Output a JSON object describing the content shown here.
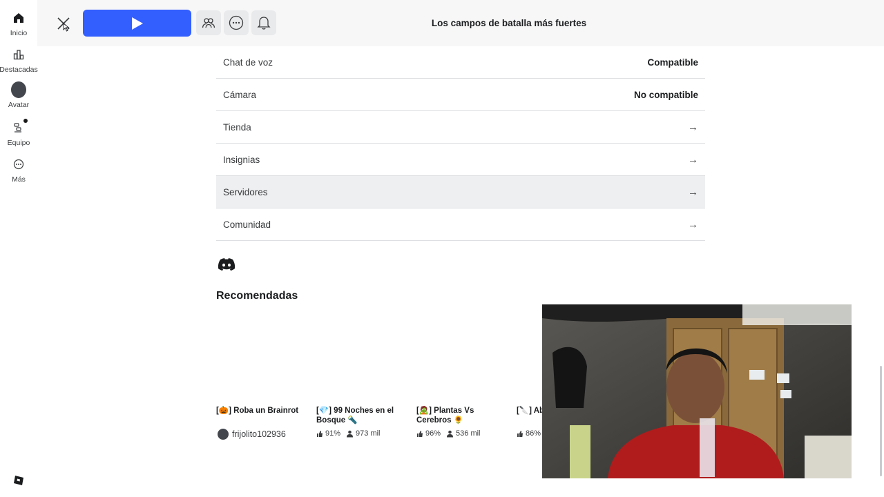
{
  "sidebar": {
    "items": [
      {
        "label": "Inicio",
        "icon": "home-icon"
      },
      {
        "label": "Destacadas",
        "icon": "charts-icon"
      },
      {
        "label": "Avatar",
        "icon": "avatar-icon"
      },
      {
        "label": "Equipo",
        "icon": "party-icon"
      },
      {
        "label": "Más",
        "icon": "more-icon"
      }
    ]
  },
  "topbar": {
    "title": "Los campos de batalla más fuertes",
    "play_color": "#335fff"
  },
  "info_rows": [
    {
      "key": "Chat de voz",
      "value": "Compatible"
    },
    {
      "key": "Cámara",
      "value": "No compatible"
    },
    {
      "key": "Tienda",
      "value": "→"
    },
    {
      "key": "Insignias",
      "value": "→"
    },
    {
      "key": "Servidores",
      "value": "→"
    },
    {
      "key": "Comunidad",
      "value": "→"
    }
  ],
  "recommended": {
    "title": "Recomendadas",
    "cards": [
      {
        "title": "[🎃] Roba un Brainrot",
        "creator": "frijolito102936"
      },
      {
        "title": "[💎] 99 Noches en el Bosque 🔦",
        "rating": "91%",
        "players": "973 mil"
      },
      {
        "title": "[🧟] Plantas Vs Cerebros 🌻",
        "rating": "96%",
        "players": "536 mil"
      },
      {
        "title": "[🔪] Ab",
        "rating": "86%"
      }
    ]
  }
}
